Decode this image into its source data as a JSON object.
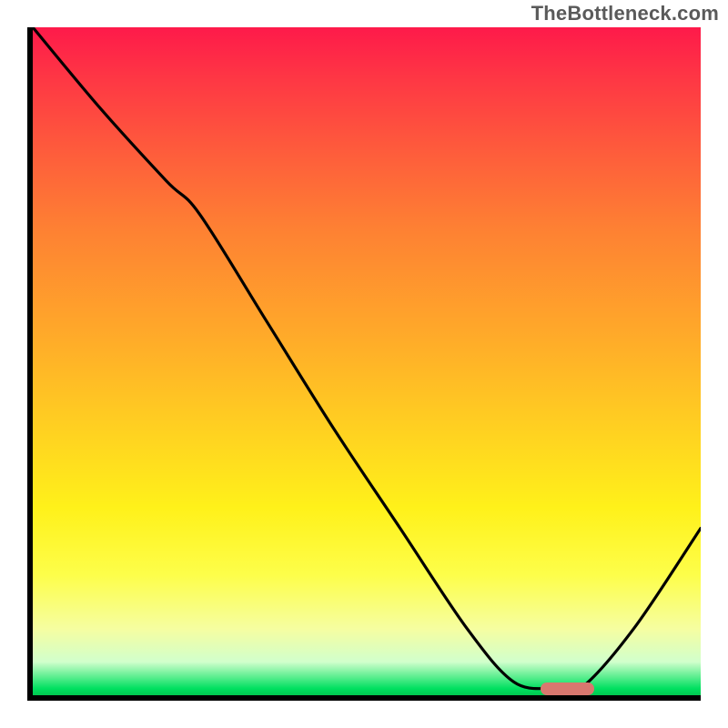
{
  "watermark": "TheBottleneck.com",
  "chart_data": {
    "type": "line",
    "title": "",
    "xlabel": "",
    "ylabel": "",
    "xlim": [
      0,
      100
    ],
    "ylim": [
      0,
      100
    ],
    "grid": false,
    "legend": false,
    "background": "gradient-red-to-green-vertical",
    "series": [
      {
        "name": "bottleneck-curve",
        "x": [
          0,
          10,
          20,
          25,
          35,
          45,
          55,
          65,
          72,
          78,
          82,
          90,
          100
        ],
        "y": [
          100,
          88,
          77,
          72,
          56,
          40,
          25,
          10,
          2,
          1,
          1,
          10,
          25
        ]
      }
    ],
    "optimal_marker": {
      "x_start": 76,
      "x_end": 84,
      "y": 1
    },
    "color_stops": [
      {
        "pos": 0.0,
        "color": "#fe1a4a"
      },
      {
        "pos": 0.18,
        "color": "#fe5a3c"
      },
      {
        "pos": 0.45,
        "color": "#ffa72a"
      },
      {
        "pos": 0.72,
        "color": "#fff11a"
      },
      {
        "pos": 0.95,
        "color": "#d1ffcc"
      },
      {
        "pos": 1.0,
        "color": "#00c850"
      }
    ]
  }
}
